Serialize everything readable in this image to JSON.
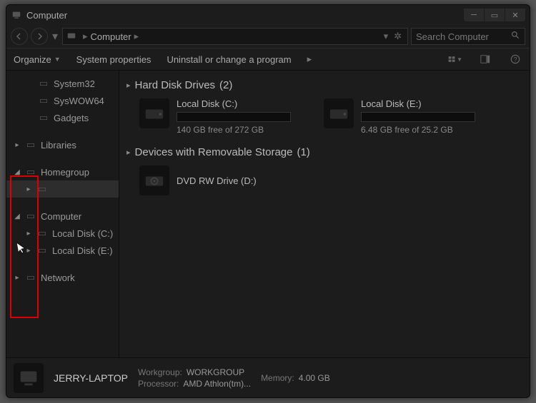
{
  "titlebar": {
    "title": "Computer"
  },
  "breadcrumb": {
    "location": "Computer"
  },
  "search": {
    "placeholder": "Search Computer"
  },
  "toolbar": {
    "organize": "Organize",
    "sysprops": "System properties",
    "uninstall": "Uninstall or change a program"
  },
  "sidebar": {
    "folders": [
      "System32",
      "SysWOW64",
      "Gadgets"
    ],
    "libraries": "Libraries",
    "homegroup": "Homegroup",
    "computer": "Computer",
    "localc": "Local Disk (C:)",
    "locale": "Local Disk (E:)",
    "network": "Network"
  },
  "groups": {
    "hdd": {
      "label": "Hard Disk Drives",
      "count": "(2)"
    },
    "removable": {
      "label": "Devices with Removable Storage",
      "count": "(1)"
    }
  },
  "drives": {
    "c": {
      "name": "Local Disk (C:)",
      "free": "140 GB free of 272 GB"
    },
    "e": {
      "name": "Local Disk (E:)",
      "free": "6.48 GB free of 25.2 GB"
    },
    "d": {
      "name": "DVD RW Drive (D:)"
    }
  },
  "details": {
    "name": "JERRY-LAPTOP",
    "workgroup_label": "Workgroup:",
    "workgroup": "WORKGROUP",
    "processor_label": "Processor:",
    "processor": "AMD Athlon(tm)...",
    "memory_label": "Memory:",
    "memory": "4.00 GB"
  }
}
